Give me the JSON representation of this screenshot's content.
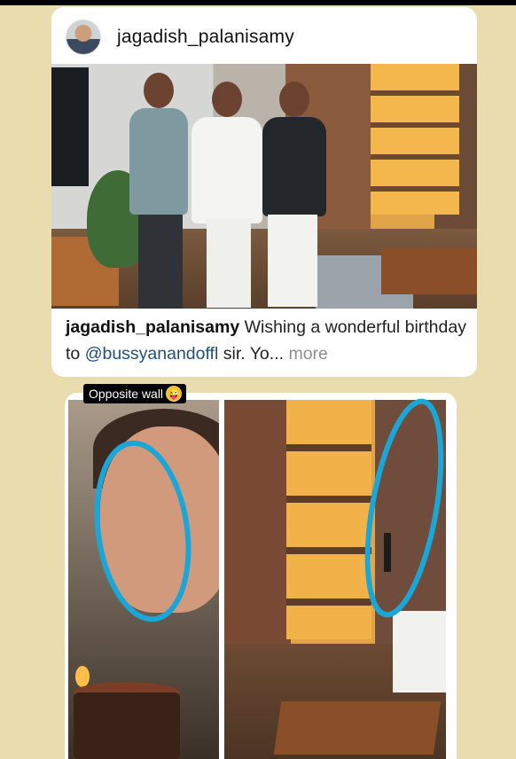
{
  "post": {
    "username": "jagadish_palanisamy",
    "caption_username": "jagadish_palanisamy",
    "caption_text_1": " Wishing a wonderful birthday to ",
    "caption_mention": "@bussyanandoffl",
    "caption_text_2": " sir. Yo...",
    "caption_more": " more"
  },
  "story": {
    "tag_label": "Opposite wall",
    "tag_emoji": "😜"
  },
  "colors": {
    "background": "#e9dcae",
    "annotation": "#1aa7d8",
    "mention": "#1d4e86"
  }
}
